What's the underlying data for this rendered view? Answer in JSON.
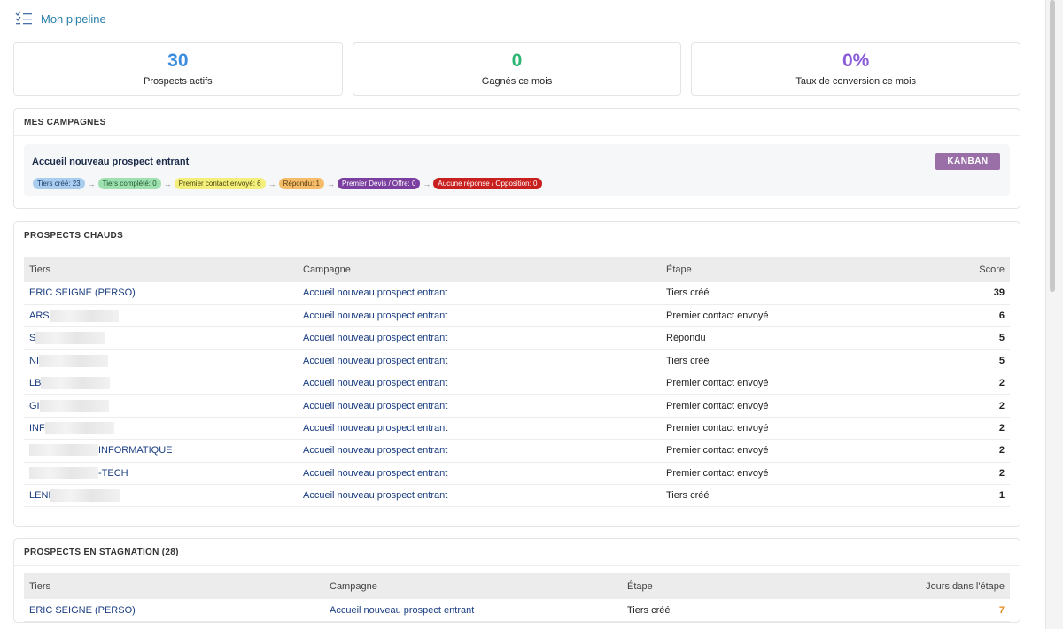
{
  "header": {
    "title": "Mon pipeline",
    "icon": "checklist-icon"
  },
  "colors": {
    "blue": "#3a8dde",
    "green": "#2bb673",
    "purple": "#8a5cd9",
    "kanban": "#9a6fa8",
    "orange": "#e08a1a"
  },
  "stats": [
    {
      "value": "30",
      "label": "Prospects actifs",
      "color": "#3a8dde"
    },
    {
      "value": "0",
      "label": "Gagnés ce mois",
      "color": "#2bb673"
    },
    {
      "value": "0%",
      "label": "Taux de conversion ce mois",
      "color": "#8a5cd9"
    }
  ],
  "campaigns": {
    "title": "MES CAMPAGNES",
    "name": "Accueil nouveau prospect entrant",
    "kanban_label": "KANBAN",
    "stages": [
      {
        "label": "Tiers créé: 23",
        "bg": "#a9cdef",
        "fg": "#1c3e6b"
      },
      {
        "label": "Tiers complété: 0",
        "bg": "#9fe0b0",
        "fg": "#1e5a30"
      },
      {
        "label": "Premier contact envoyé: 6",
        "bg": "#f3ef7a",
        "fg": "#4b4510"
      },
      {
        "label": "Répondu: 1",
        "bg": "#f5bd6a",
        "fg": "#5a3a10"
      },
      {
        "label": "Premier Devis / Offre: 0",
        "bg": "#7b3fa0",
        "fg": "#ffffff"
      },
      {
        "label": "Aucune réponse / Opposition: 0",
        "bg": "#c8201e",
        "fg": "#ffffff"
      }
    ]
  },
  "hot": {
    "title": "PROSPECTS CHAUDS",
    "columns": [
      "Tiers",
      "Campagne",
      "Étape",
      "Score"
    ],
    "rows": [
      {
        "tiers": "ERIC SEIGNE (PERSO)",
        "campagne": "Accueil nouveau prospect entrant",
        "etape": "Tiers créé",
        "score": "39"
      },
      {
        "tiers": "ARS",
        "campagne": "Accueil nouveau prospect entrant",
        "etape": "Premier contact envoyé",
        "score": "6"
      },
      {
        "tiers": "S",
        "campagne": "Accueil nouveau prospect entrant",
        "etape": "Répondu",
        "score": "5"
      },
      {
        "tiers": "NI",
        "campagne": "Accueil nouveau prospect entrant",
        "etape": "Tiers créé",
        "score": "5"
      },
      {
        "tiers": "LB",
        "campagne": "Accueil nouveau prospect entrant",
        "etape": "Premier contact envoyé",
        "score": "2"
      },
      {
        "tiers": "GI",
        "campagne": "Accueil nouveau prospect entrant",
        "etape": "Premier contact envoyé",
        "score": "2"
      },
      {
        "tiers": "INF",
        "campagne": "Accueil nouveau prospect entrant",
        "etape": "Premier contact envoyé",
        "score": "2"
      },
      {
        "tiers": "INFORMATIQUE",
        "campagne": "Accueil nouveau prospect entrant",
        "etape": "Premier contact envoyé",
        "score": "2"
      },
      {
        "tiers": "-TECH",
        "campagne": "Accueil nouveau prospect entrant",
        "etape": "Premier contact envoyé",
        "score": "2"
      },
      {
        "tiers": "LENI",
        "campagne": "Accueil nouveau prospect entrant",
        "etape": "Tiers créé",
        "score": "1"
      }
    ]
  },
  "stagnation": {
    "title": "PROSPECTS EN STAGNATION (28)",
    "columns": [
      "Tiers",
      "Campagne",
      "Étape",
      "Jours dans l'étape"
    ],
    "rows": [
      {
        "tiers": "ERIC SEIGNE (PERSO)",
        "campagne": "Accueil nouveau prospect entrant",
        "etape": "Tiers créé",
        "jours": "7"
      }
    ]
  }
}
